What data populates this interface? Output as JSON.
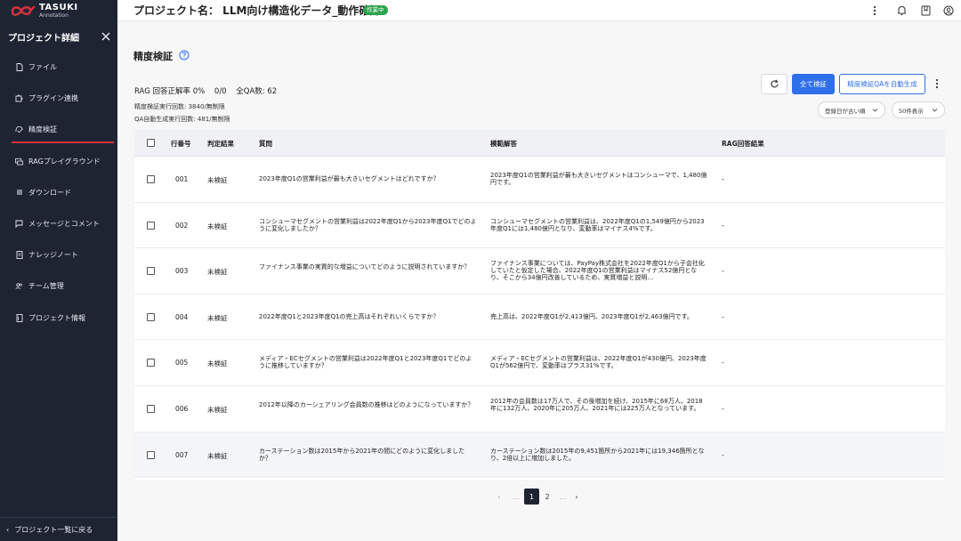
{
  "brand": {
    "name": "TASUKI",
    "sub": "Annotation"
  },
  "sidebar": {
    "heading": "プロジェクト詳細",
    "items": [
      {
        "label": "ファイル",
        "icon": "file-icon"
      },
      {
        "label": "プラグイン連携",
        "icon": "plugin-icon"
      },
      {
        "label": "精度検証",
        "icon": "accuracy-icon",
        "active": true
      },
      {
        "label": "RAGプレイグラウンド",
        "icon": "rag-icon"
      },
      {
        "label": "ダウンロード",
        "icon": "download-icon"
      },
      {
        "label": "メッセージとコメント",
        "icon": "message-icon"
      },
      {
        "label": "ナレッジノート",
        "icon": "note-icon"
      },
      {
        "label": "チーム管理",
        "icon": "team-icon"
      },
      {
        "label": "プロジェクト情報",
        "icon": "info-icon"
      }
    ],
    "footer": "プロジェクト一覧に戻る"
  },
  "header": {
    "project_title": "プロジェクト名： LLM向け構造化データ_動作確認",
    "status": "作業中"
  },
  "page": {
    "heading": "精度検証",
    "stats": {
      "accuracy": "RAG 回答正解率 0%",
      "ratio": "0/0",
      "total": "全QA数: 62",
      "runs": "精度検証実行回数: 3840/無制限",
      "autogen": "QA自動生成実行回数: 481/無制限"
    },
    "buttons": {
      "verify_all": "全て検証",
      "autogen": "精度検証QAを自動生成"
    },
    "sort": "登録日が古い順",
    "per_page": "50件表示"
  },
  "table": {
    "headers": [
      "行番号",
      "判定結果",
      "質問",
      "模範解答",
      "RAG回答結果"
    ],
    "rows": [
      {
        "num": "001",
        "status": "未検証",
        "question": "2023年度Q1の営業利益が最も大きいセグメントはどれですか？",
        "answer": "2023年度Q1の営業利益が最も大きいセグメントはコンシューマで、1,480億円です。",
        "rag": "-"
      },
      {
        "num": "002",
        "status": "未検証",
        "question": "コンシューマセグメントの営業利益は2022年度Q1から2023年度Q1でどのように変化しましたか？",
        "answer": "コンシューマセグメントの営業利益は、2022年度Q1の1,549億円から2023年度Q1には1,480億円となり、変動率はマイナス4%です。",
        "rag": "-"
      },
      {
        "num": "003",
        "status": "未検証",
        "question": "ファイナンス事業の実質的な増益についてどのように説明されていますか？",
        "answer": "ファイナンス事業については、PayPay株式会社を2022年度Q1から子会社化していたと仮定した場合、2022年度Q1の営業利益はマイナス52億円となり、そこから34億円改善しているため、実質増益と説明…",
        "rag": "-"
      },
      {
        "num": "004",
        "status": "未検証",
        "question": "2022年度Q1と2023年度Q1の売上高はそれぞれいくらですか？",
        "answer": "売上高は、2022年度Q1が2,413億円、2023年度Q1が2,463億円です。",
        "rag": "-"
      },
      {
        "num": "005",
        "status": "未検証",
        "question": "メディア・ECセグメントの営業利益は2022年度Q1と2023年度Q1でどのように推移していますか？",
        "answer": "メディア・ECセグメントの営業利益は、2022年度Q1が430億円、2023年度Q1が562億円で、変動率はプラス31%です。",
        "rag": "-"
      },
      {
        "num": "006",
        "status": "未検証",
        "question": "2012年以降のカーシェアリング会員数の推移はどのようになっていますか？",
        "answer": "2012年の会員数は17万人で、その後増加を続け、2015年に68万人、2018年に132万人、2020年に205万人、2021年には225万人となっています。",
        "rag": "-"
      },
      {
        "num": "007",
        "status": "未検証",
        "question": "カーステーション数は2015年から2021年の間にどのように変化しましたか？",
        "answer": "カーステーション数は2015年の9,451箇所から2021年には19,346箇所となり、2倍以上に増加しました。",
        "rag": "-"
      }
    ]
  },
  "pagination": {
    "prev": "‹",
    "ellipsis_left": "…",
    "pages": [
      "1",
      "2"
    ],
    "current": "1",
    "ellipsis_right": "…",
    "next": "›"
  }
}
